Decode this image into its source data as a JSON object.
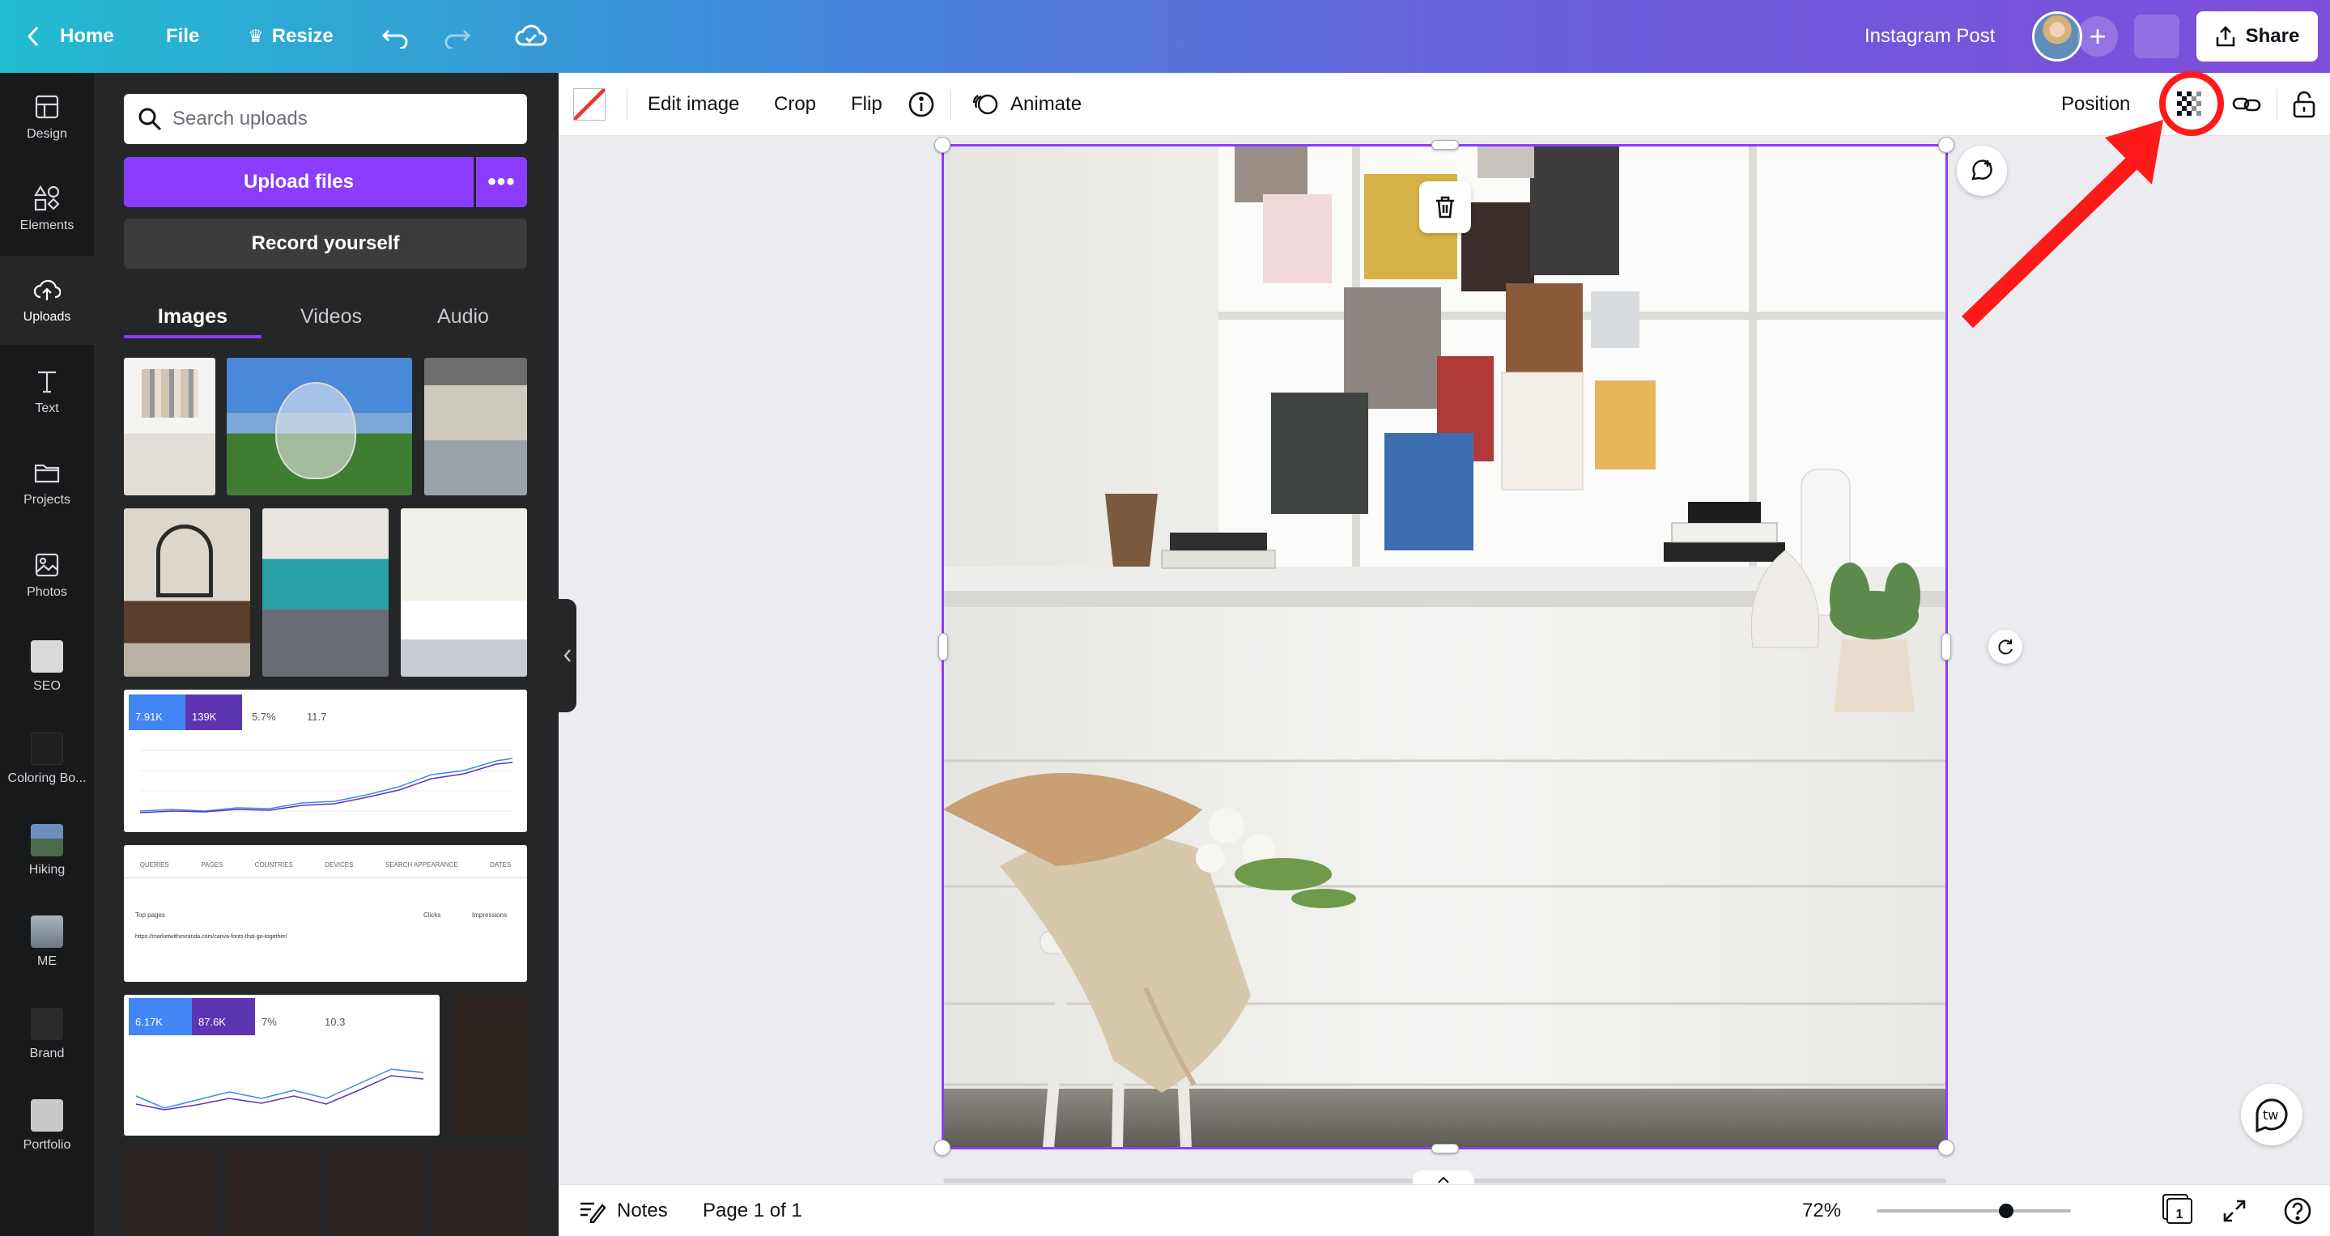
{
  "topbar": {
    "home": "Home",
    "file": "File",
    "resize": "Resize",
    "doc_title": "Instagram Post",
    "share": "Share"
  },
  "rail": {
    "design": "Design",
    "elements": "Elements",
    "uploads": "Uploads",
    "text": "Text",
    "projects": "Projects",
    "photos": "Photos",
    "seo": "SEO",
    "coloring": "Coloring Bo...",
    "hiking": "Hiking",
    "me": "ME",
    "brand": "Brand",
    "portfolio": "Portfolio"
  },
  "panel": {
    "search_placeholder": "Search uploads",
    "upload_files": "Upload files",
    "record_yourself": "Record yourself",
    "tabs": [
      "Images",
      "Videos",
      "Audio"
    ],
    "analytics1": {
      "clicks": "7.91K",
      "impressions": "139K",
      "ctr": "5.7%",
      "position": "11.7"
    },
    "analytics2": {
      "tabs": [
        "QUERIES",
        "PAGES",
        "COUNTRIES",
        "DEVICES",
        "SEARCH APPEARANCE",
        "DATES"
      ],
      "row_url": "https://marketwithmiranda.com/canva-fonts-that-go-together/",
      "clicks_header": "Clicks",
      "impressions_header": "Impressions",
      "top_pages": "Top pages"
    },
    "analytics3": {
      "clicks": "6.17K",
      "impressions": "87.6K",
      "ctr": "7%",
      "position": "10.3"
    }
  },
  "toolbar": {
    "edit_image": "Edit image",
    "crop": "Crop",
    "flip": "Flip",
    "animate": "Animate",
    "position": "Position"
  },
  "bottombar": {
    "notes": "Notes",
    "page_indicator": "Page 1 of 1",
    "zoom": "72%",
    "page_count": "1",
    "zoom_level": 0.72
  },
  "colors": {
    "accent": "#8b3dff",
    "annotation": "#ff1a1a",
    "panel_bg": "#252627",
    "rail_bg": "#18191b"
  }
}
